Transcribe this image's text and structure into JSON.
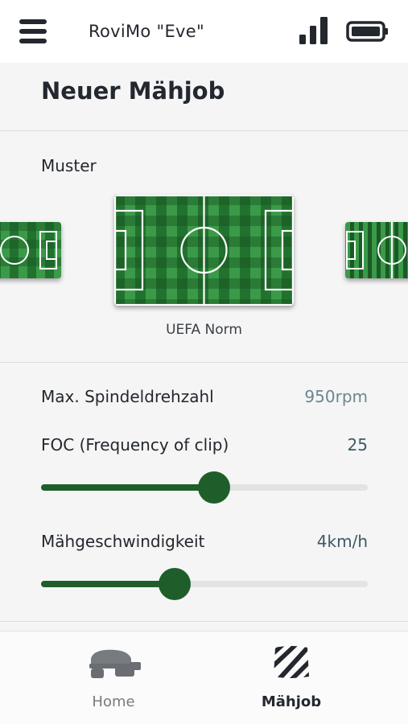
{
  "header": {
    "device_name": "RoviMo \"Eve\"",
    "menu_icon": "hamburger-menu-icon",
    "signal_icon": "signal-strength-icon",
    "battery_icon": "battery-full-icon"
  },
  "page": {
    "title": "Neuer Mähjob"
  },
  "pattern": {
    "section_label": "Muster",
    "selected_name": "UEFA Norm",
    "carousel": [
      "checker-pattern",
      "UEFA Norm",
      "stripe-pattern"
    ]
  },
  "settings": {
    "spindle": {
      "label": "Max. Spindeldrehzahl",
      "value": "950rpm"
    },
    "foc": {
      "label": "FOC (Frequency of clip)",
      "value": "25",
      "slider_fraction": 0.53
    },
    "speed": {
      "label": "Mähgeschwindigkeit",
      "value": "4km/h",
      "slider_fraction": 0.41
    }
  },
  "nav": {
    "items": [
      {
        "label": "Home",
        "icon": "robot-mower-icon",
        "active": false
      },
      {
        "label": "Mähjob",
        "icon": "mow-pattern-icon",
        "active": true
      }
    ]
  },
  "colors": {
    "accent": "#1f5e2a",
    "grass_light": "#3a9a48",
    "grass_dark": "#1f6b2c",
    "value_text": "#6b8790"
  }
}
